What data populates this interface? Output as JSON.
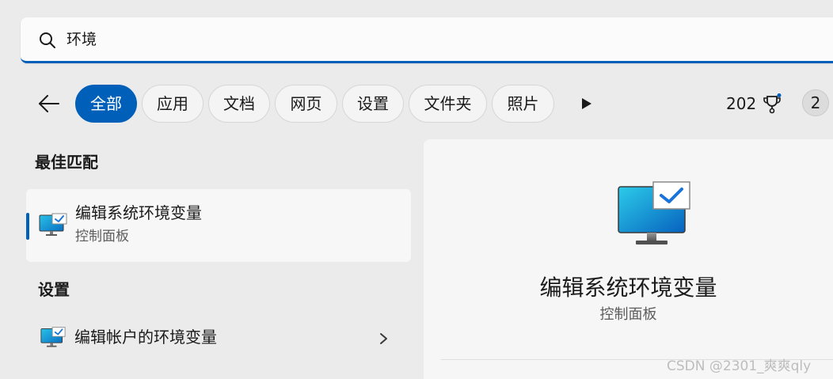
{
  "search": {
    "query": "环境"
  },
  "filters": {
    "chips": [
      {
        "label": "全部",
        "active": true
      },
      {
        "label": "应用",
        "active": false
      },
      {
        "label": "文档",
        "active": false
      },
      {
        "label": "网页",
        "active": false
      },
      {
        "label": "设置",
        "active": false
      },
      {
        "label": "文件夹",
        "active": false
      },
      {
        "label": "照片",
        "active": false
      }
    ]
  },
  "header": {
    "points": "202",
    "avatar_label": "2"
  },
  "results": {
    "best_match_heading": "最佳匹配",
    "best_match": {
      "title": "编辑系统环境变量",
      "subtitle": "控制面板",
      "icon": "monitor-checkmark-icon"
    },
    "settings_heading": "设置",
    "settings_items": [
      {
        "title": "编辑帐户的环境变量",
        "icon": "monitor-checkmark-icon"
      }
    ]
  },
  "detail": {
    "title": "编辑系统环境变量",
    "subtitle": "控制面板",
    "icon": "monitor-checkmark-icon"
  },
  "watermark": "CSDN @2301_爽爽qly",
  "colors": {
    "accent": "#005fb8",
    "background": "#ebebeb",
    "panel": "#f6f6f6",
    "card": "#f7f7f7"
  }
}
